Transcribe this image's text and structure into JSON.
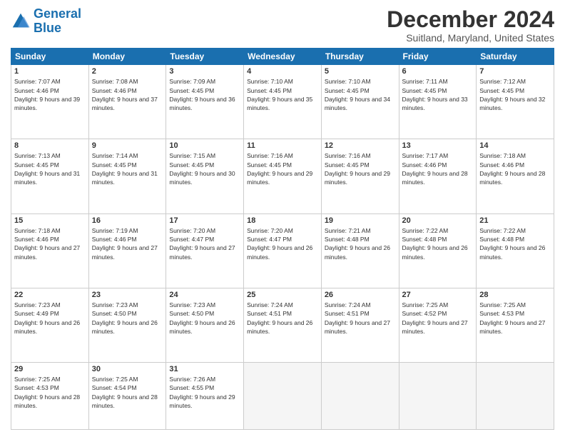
{
  "logo": {
    "text_general": "General",
    "text_blue": "Blue"
  },
  "header": {
    "title": "December 2024",
    "subtitle": "Suitland, Maryland, United States"
  },
  "weekdays": [
    "Sunday",
    "Monday",
    "Tuesday",
    "Wednesday",
    "Thursday",
    "Friday",
    "Saturday"
  ],
  "weeks": [
    [
      {
        "day": "1",
        "sunrise": "Sunrise: 7:07 AM",
        "sunset": "Sunset: 4:46 PM",
        "daylight": "Daylight: 9 hours and 39 minutes."
      },
      {
        "day": "2",
        "sunrise": "Sunrise: 7:08 AM",
        "sunset": "Sunset: 4:46 PM",
        "daylight": "Daylight: 9 hours and 37 minutes."
      },
      {
        "day": "3",
        "sunrise": "Sunrise: 7:09 AM",
        "sunset": "Sunset: 4:45 PM",
        "daylight": "Daylight: 9 hours and 36 minutes."
      },
      {
        "day": "4",
        "sunrise": "Sunrise: 7:10 AM",
        "sunset": "Sunset: 4:45 PM",
        "daylight": "Daylight: 9 hours and 35 minutes."
      },
      {
        "day": "5",
        "sunrise": "Sunrise: 7:10 AM",
        "sunset": "Sunset: 4:45 PM",
        "daylight": "Daylight: 9 hours and 34 minutes."
      },
      {
        "day": "6",
        "sunrise": "Sunrise: 7:11 AM",
        "sunset": "Sunset: 4:45 PM",
        "daylight": "Daylight: 9 hours and 33 minutes."
      },
      {
        "day": "7",
        "sunrise": "Sunrise: 7:12 AM",
        "sunset": "Sunset: 4:45 PM",
        "daylight": "Daylight: 9 hours and 32 minutes."
      }
    ],
    [
      {
        "day": "8",
        "sunrise": "Sunrise: 7:13 AM",
        "sunset": "Sunset: 4:45 PM",
        "daylight": "Daylight: 9 hours and 31 minutes."
      },
      {
        "day": "9",
        "sunrise": "Sunrise: 7:14 AM",
        "sunset": "Sunset: 4:45 PM",
        "daylight": "Daylight: 9 hours and 31 minutes."
      },
      {
        "day": "10",
        "sunrise": "Sunrise: 7:15 AM",
        "sunset": "Sunset: 4:45 PM",
        "daylight": "Daylight: 9 hours and 30 minutes."
      },
      {
        "day": "11",
        "sunrise": "Sunrise: 7:16 AM",
        "sunset": "Sunset: 4:45 PM",
        "daylight": "Daylight: 9 hours and 29 minutes."
      },
      {
        "day": "12",
        "sunrise": "Sunrise: 7:16 AM",
        "sunset": "Sunset: 4:45 PM",
        "daylight": "Daylight: 9 hours and 29 minutes."
      },
      {
        "day": "13",
        "sunrise": "Sunrise: 7:17 AM",
        "sunset": "Sunset: 4:46 PM",
        "daylight": "Daylight: 9 hours and 28 minutes."
      },
      {
        "day": "14",
        "sunrise": "Sunrise: 7:18 AM",
        "sunset": "Sunset: 4:46 PM",
        "daylight": "Daylight: 9 hours and 28 minutes."
      }
    ],
    [
      {
        "day": "15",
        "sunrise": "Sunrise: 7:18 AM",
        "sunset": "Sunset: 4:46 PM",
        "daylight": "Daylight: 9 hours and 27 minutes."
      },
      {
        "day": "16",
        "sunrise": "Sunrise: 7:19 AM",
        "sunset": "Sunset: 4:46 PM",
        "daylight": "Daylight: 9 hours and 27 minutes."
      },
      {
        "day": "17",
        "sunrise": "Sunrise: 7:20 AM",
        "sunset": "Sunset: 4:47 PM",
        "daylight": "Daylight: 9 hours and 27 minutes."
      },
      {
        "day": "18",
        "sunrise": "Sunrise: 7:20 AM",
        "sunset": "Sunset: 4:47 PM",
        "daylight": "Daylight: 9 hours and 26 minutes."
      },
      {
        "day": "19",
        "sunrise": "Sunrise: 7:21 AM",
        "sunset": "Sunset: 4:48 PM",
        "daylight": "Daylight: 9 hours and 26 minutes."
      },
      {
        "day": "20",
        "sunrise": "Sunrise: 7:22 AM",
        "sunset": "Sunset: 4:48 PM",
        "daylight": "Daylight: 9 hours and 26 minutes."
      },
      {
        "day": "21",
        "sunrise": "Sunrise: 7:22 AM",
        "sunset": "Sunset: 4:48 PM",
        "daylight": "Daylight: 9 hours and 26 minutes."
      }
    ],
    [
      {
        "day": "22",
        "sunrise": "Sunrise: 7:23 AM",
        "sunset": "Sunset: 4:49 PM",
        "daylight": "Daylight: 9 hours and 26 minutes."
      },
      {
        "day": "23",
        "sunrise": "Sunrise: 7:23 AM",
        "sunset": "Sunset: 4:50 PM",
        "daylight": "Daylight: 9 hours and 26 minutes."
      },
      {
        "day": "24",
        "sunrise": "Sunrise: 7:23 AM",
        "sunset": "Sunset: 4:50 PM",
        "daylight": "Daylight: 9 hours and 26 minutes."
      },
      {
        "day": "25",
        "sunrise": "Sunrise: 7:24 AM",
        "sunset": "Sunset: 4:51 PM",
        "daylight": "Daylight: 9 hours and 26 minutes."
      },
      {
        "day": "26",
        "sunrise": "Sunrise: 7:24 AM",
        "sunset": "Sunset: 4:51 PM",
        "daylight": "Daylight: 9 hours and 27 minutes."
      },
      {
        "day": "27",
        "sunrise": "Sunrise: 7:25 AM",
        "sunset": "Sunset: 4:52 PM",
        "daylight": "Daylight: 9 hours and 27 minutes."
      },
      {
        "day": "28",
        "sunrise": "Sunrise: 7:25 AM",
        "sunset": "Sunset: 4:53 PM",
        "daylight": "Daylight: 9 hours and 27 minutes."
      }
    ],
    [
      {
        "day": "29",
        "sunrise": "Sunrise: 7:25 AM",
        "sunset": "Sunset: 4:53 PM",
        "daylight": "Daylight: 9 hours and 28 minutes."
      },
      {
        "day": "30",
        "sunrise": "Sunrise: 7:25 AM",
        "sunset": "Sunset: 4:54 PM",
        "daylight": "Daylight: 9 hours and 28 minutes."
      },
      {
        "day": "31",
        "sunrise": "Sunrise: 7:26 AM",
        "sunset": "Sunset: 4:55 PM",
        "daylight": "Daylight: 9 hours and 29 minutes."
      },
      null,
      null,
      null,
      null
    ]
  ]
}
